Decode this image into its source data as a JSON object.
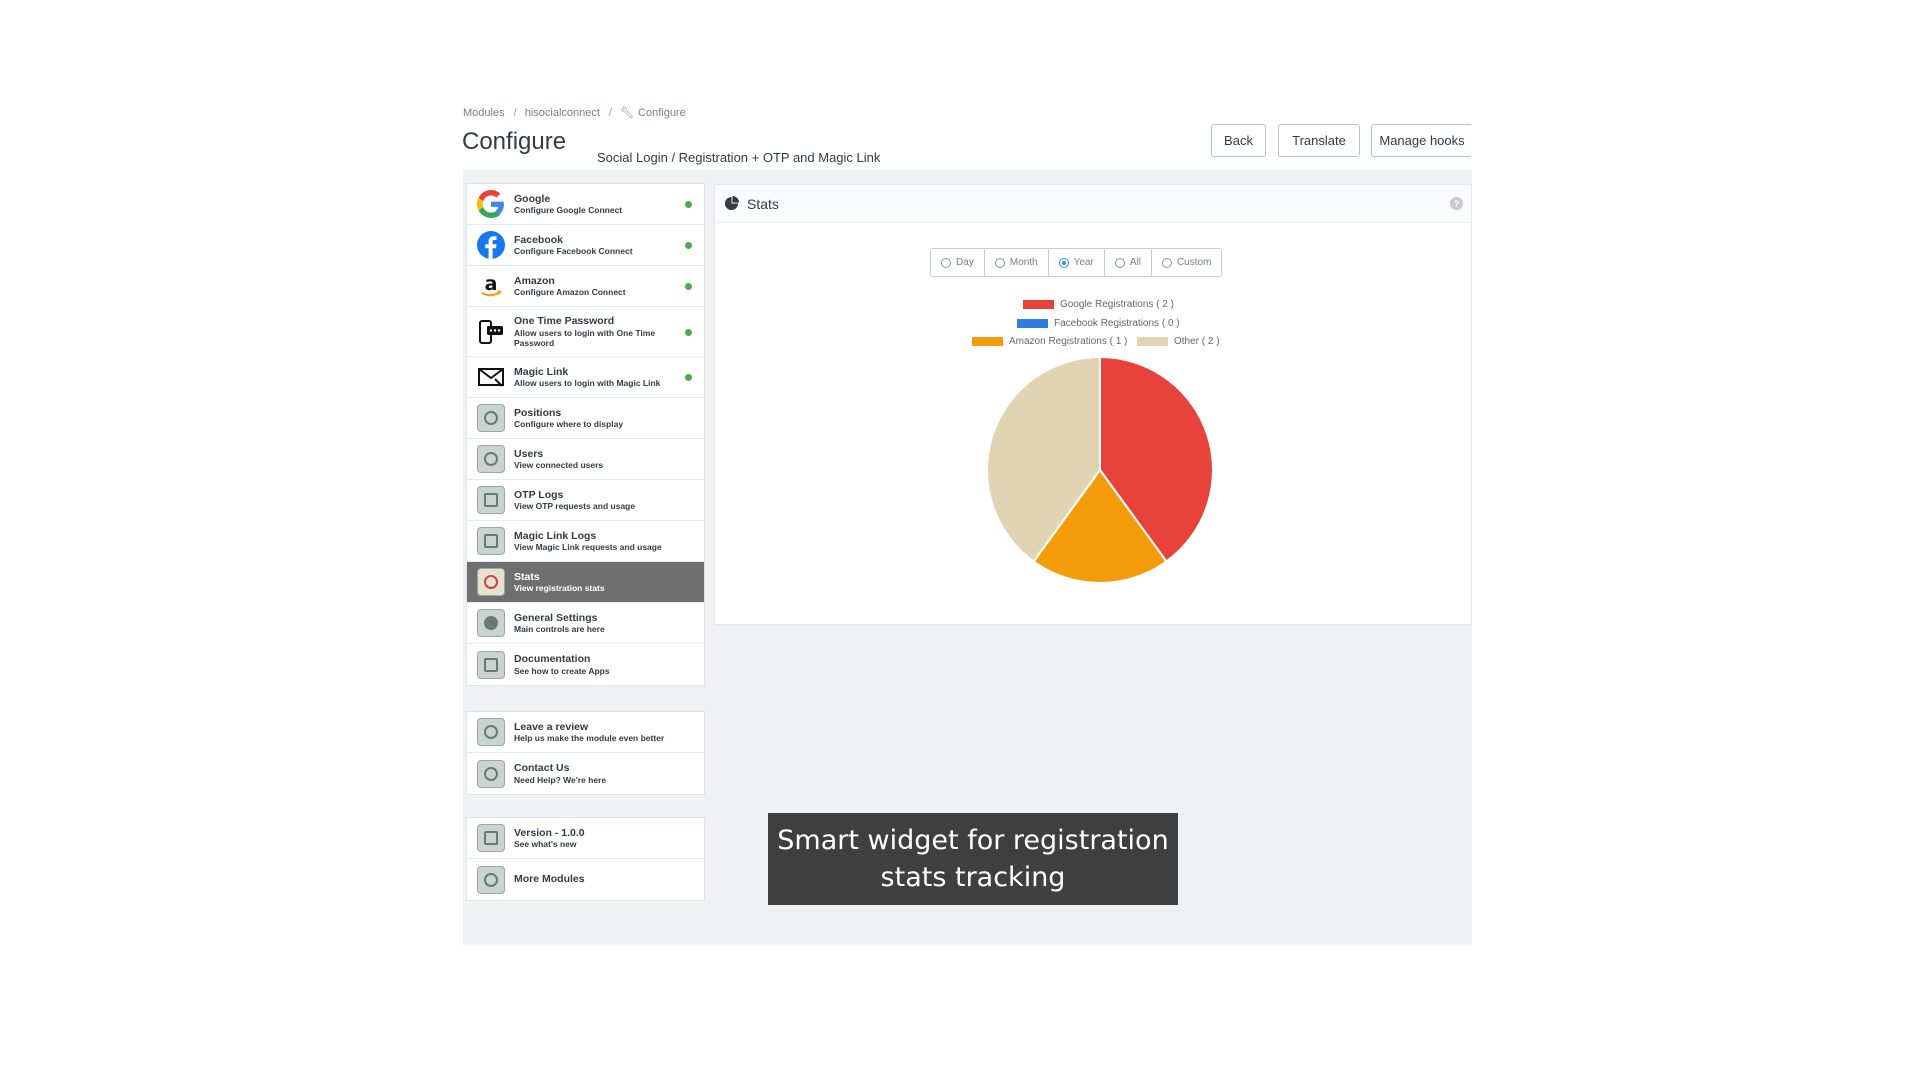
{
  "breadcrumb": [
    "Modules",
    "hisocialconnect",
    "Configure"
  ],
  "page": {
    "title": "Configure",
    "subtitle": "Social Login / Registration + OTP and Magic Link"
  },
  "header_buttons": {
    "back": "Back",
    "translate": "Translate",
    "manage_hooks": "Manage hooks"
  },
  "sidebar": {
    "main": [
      {
        "title": "Google",
        "desc": "Configure Google Connect",
        "icon": "google-icon",
        "enabled": true
      },
      {
        "title": "Facebook",
        "desc": "Configure Facebook Connect",
        "icon": "facebook-icon",
        "enabled": true
      },
      {
        "title": "Amazon",
        "desc": "Configure Amazon Connect",
        "icon": "amazon-icon",
        "enabled": true
      },
      {
        "title": "One Time Password",
        "desc": "Allow users to login with One Time Password",
        "icon": "otp-icon",
        "enabled": true
      },
      {
        "title": "Magic Link",
        "desc": "Allow users to login with Magic Link",
        "icon": "envelope-icon",
        "enabled": true
      },
      {
        "title": "Positions",
        "desc": "Configure where to display",
        "icon": "positions-icon"
      },
      {
        "title": "Users",
        "desc": "View connected users",
        "icon": "users-icon"
      },
      {
        "title": "OTP Logs",
        "desc": "View OTP requests and usage",
        "icon": "otp-logs-icon"
      },
      {
        "title": "Magic Link Logs",
        "desc": "View Magic Link requests and usage",
        "icon": "magic-link-logs-icon"
      },
      {
        "title": "Stats",
        "desc": "View registration stats",
        "icon": "stats-icon",
        "active": true
      },
      {
        "title": "General Settings",
        "desc": "Main controls are here",
        "icon": "settings-icon"
      },
      {
        "title": "Documentation",
        "desc": "See how to create Apps",
        "icon": "documentation-icon"
      }
    ],
    "support": [
      {
        "title": "Leave a review",
        "desc": "Help us make the module even better",
        "icon": "review-icon"
      },
      {
        "title": "Contact Us",
        "desc": "Need Help? We're here",
        "icon": "contact-icon"
      }
    ],
    "extra": [
      {
        "title": "Version - 1.0.0",
        "desc": "See what's new",
        "icon": "version-icon"
      },
      {
        "title": "More Modules",
        "desc": "",
        "icon": "modules-icon"
      }
    ]
  },
  "stats_panel": {
    "title": "Stats",
    "help": "?",
    "range_options": [
      "Day",
      "Month",
      "Year",
      "All",
      "Custom"
    ],
    "selected_range": "Year"
  },
  "chart_data": {
    "type": "pie",
    "title": "",
    "series": [
      {
        "name": "Google Registrations ( 2 )",
        "value": 2,
        "color": "#e8433a"
      },
      {
        "name": "Facebook Registrations ( 0 )",
        "value": 0,
        "color": "#2f7de1"
      },
      {
        "name": "Amazon Registrations ( 1 )",
        "value": 1,
        "color": "#f59c0b"
      },
      {
        "name": "Other ( 2 )",
        "value": 2,
        "color": "#e0d4b4"
      }
    ],
    "legend": "top"
  },
  "caption": "Smart widget for registration stats tracking"
}
